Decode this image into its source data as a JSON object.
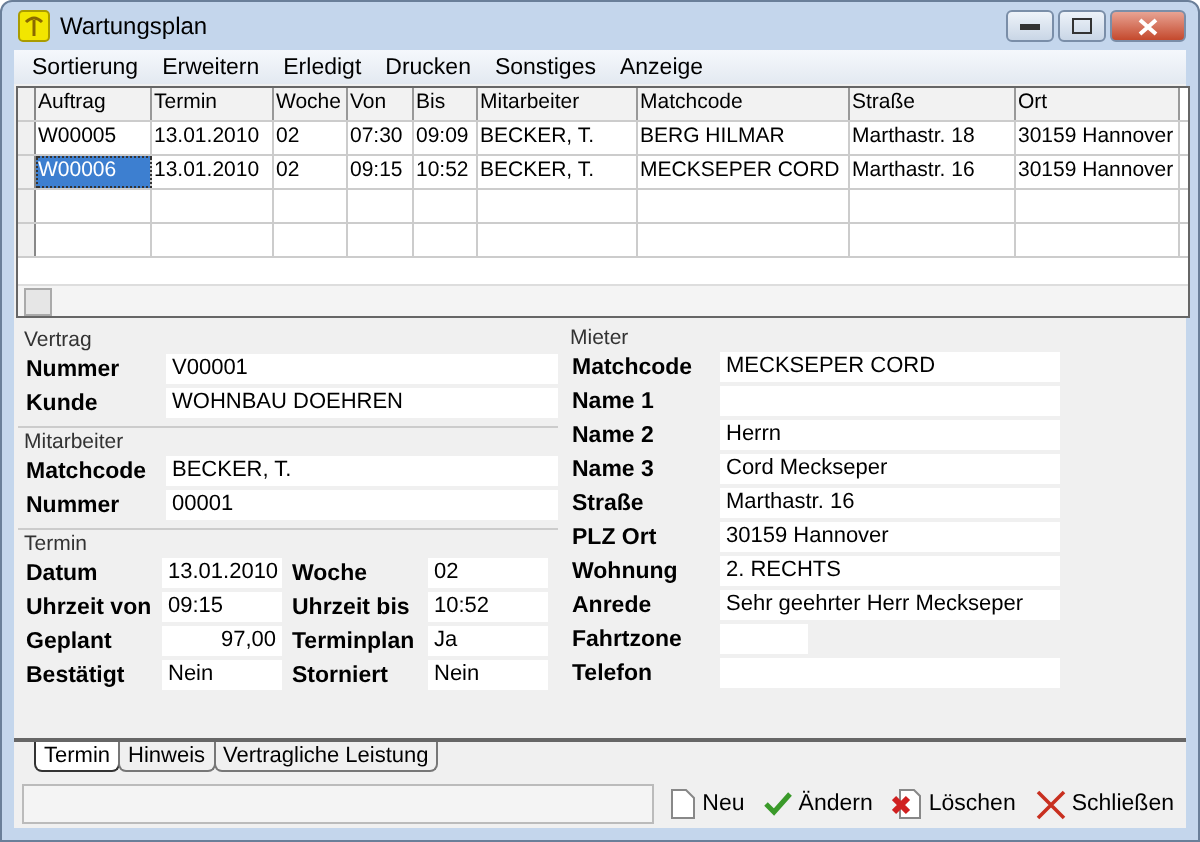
{
  "window": {
    "title": "Wartungsplan"
  },
  "menu": [
    "Sortierung",
    "Erweitern",
    "Erledigt",
    "Drucken",
    "Sonstiges",
    "Anzeige"
  ],
  "table": {
    "columns": [
      "Auftrag",
      "Termin",
      "Woche",
      "Von",
      "Bis",
      "Mitarbeiter",
      "Matchcode",
      "Straße",
      "Ort"
    ],
    "rows": [
      {
        "selected": false,
        "cells": [
          "W00005",
          "13.01.2010",
          "02",
          "07:30",
          "09:09",
          "BECKER, T.",
          "BERG HILMAR",
          "Marthastr. 18",
          "30159 Hannover"
        ]
      },
      {
        "selected": true,
        "cells": [
          "W00006",
          "13.01.2010",
          "02",
          "09:15",
          "10:52",
          "BECKER, T.",
          "MECKSEPER CORD",
          "Marthastr. 16",
          "30159 Hannover"
        ]
      }
    ]
  },
  "vertrag": {
    "title": "Vertrag",
    "fields": [
      {
        "label": "Nummer",
        "value": "V00001"
      },
      {
        "label": "Kunde",
        "value": "WOHNBAU DOEHREN"
      }
    ]
  },
  "mitarbeiter": {
    "title": "Mitarbeiter",
    "fields": [
      {
        "label": "Matchcode",
        "value": "BECKER, T."
      },
      {
        "label": "Nummer",
        "value": "00001"
      }
    ]
  },
  "termin": {
    "title": "Termin",
    "fields": [
      {
        "label": "Datum",
        "value": "13.01.2010"
      },
      {
        "label": "Woche",
        "value": "02"
      },
      {
        "label": "Uhrzeit von",
        "value": "09:15"
      },
      {
        "label": "Uhrzeit bis",
        "value": "10:52"
      },
      {
        "label": "Geplant",
        "value": "97,00",
        "numeric": true
      },
      {
        "label": "Terminplan",
        "value": "Ja"
      },
      {
        "label": "Bestätigt",
        "value": "Nein"
      },
      {
        "label": "Storniert",
        "value": "Nein"
      }
    ]
  },
  "mieter": {
    "title": "Mieter",
    "fields": [
      {
        "label": "Matchcode",
        "value": "MECKSEPER CORD"
      },
      {
        "label": "Name 1"
      },
      {
        "label": "Name 2",
        "value": "Herrn"
      },
      {
        "label": "Name 3",
        "value": "Cord Meckseper"
      },
      {
        "label": "Straße",
        "value": "Marthastr. 16"
      },
      {
        "label": "PLZ Ort",
        "value": "30159 Hannover"
      },
      {
        "label": "Wohnung",
        "value": "2. RECHTS"
      },
      {
        "label": "Anrede",
        "value": "Sehr geehrter Herr Meckseper"
      },
      {
        "label": "Fahrtzone",
        "short": true
      },
      {
        "label": "Telefon"
      }
    ]
  },
  "tabs": [
    {
      "label": "Termin",
      "selected": true
    },
    {
      "label": "Hinweis",
      "selected": false
    },
    {
      "label": "Vertragliche Leistung",
      "selected": false
    }
  ],
  "buttons": [
    {
      "kind": "new",
      "label": "Neu"
    },
    {
      "kind": "edit",
      "label": "Ändern"
    },
    {
      "kind": "delete",
      "label": "Löschen"
    },
    {
      "kind": "close",
      "label": "Schließen"
    }
  ]
}
